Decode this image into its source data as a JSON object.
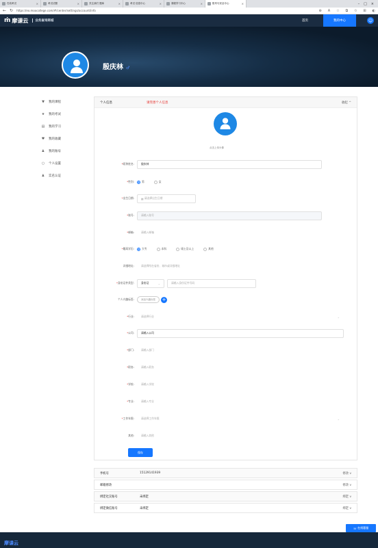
{
  "browser": {
    "tabs": [
      {
        "label": "在线考试"
      },
      {
        "label": "考试试题"
      },
      {
        "label": "关注我们 题库"
      },
      {
        "label": "考试 信息中心"
      },
      {
        "label": "课程学习中心"
      },
      {
        "label": "账号与安全中心"
      }
    ],
    "url": "https://eo.moocollege.com/#/center/settings/account/info"
  },
  "header": {
    "logo": "摩课云",
    "subtitle": "业务查询商城",
    "link": "首页",
    "cta": "我的中心"
  },
  "profile": {
    "name": "殷庆林",
    "gender_symbol": "♂"
  },
  "sidebar": {
    "items": [
      {
        "icon": "bookmark-icon",
        "glyph": "▼",
        "label": "我的课程"
      },
      {
        "icon": "star-icon",
        "glyph": "★",
        "label": "我的考试"
      },
      {
        "icon": "book-icon",
        "glyph": "▤",
        "label": "我的学习"
      },
      {
        "icon": "heart-icon",
        "glyph": "♥",
        "label": "我的收藏"
      },
      {
        "icon": "user-icon",
        "glyph": "♟",
        "label": "我的账号"
      },
      {
        "icon": "gear-icon",
        "glyph": "○",
        "label": "个人设置"
      },
      {
        "icon": "person-icon",
        "glyph": "♟",
        "label": "实名认证"
      }
    ]
  },
  "main": {
    "title": "个人信息",
    "notice": "请完善个人信息",
    "fold": "收起 ^",
    "upload_label": "点击上传头像",
    "fields": {
      "nickname": {
        "label": "昵称姓名",
        "value": "殷庆林"
      },
      "gender": {
        "label": "性别",
        "options": [
          "男",
          "女"
        ],
        "selected": "男"
      },
      "birthday": {
        "label": "出生日期",
        "placeholder": "请选择出生日期"
      },
      "account": {
        "label": "账号",
        "placeholder": "请输入账号"
      },
      "email": {
        "label": "邮箱",
        "placeholder": "请输入邮箱"
      },
      "education": {
        "label": "最高学历",
        "options": [
          "大专",
          "本科",
          "硕士及以上",
          "其他"
        ],
        "selected": "大专"
      },
      "address": {
        "label": "详细地址",
        "placeholder": "请选择所在省份、城市或详细地址"
      },
      "id": {
        "label": "身份证件类型",
        "type": "身份证",
        "placeholder": "请输入身份证件号码"
      },
      "tags": {
        "label": "个人兴趣标签",
        "button": "添加兴趣标签"
      },
      "industry": {
        "label": "行业",
        "placeholder": "请选择行业"
      },
      "company": {
        "label": "公司",
        "value": "请输入公司"
      },
      "dept": {
        "label": "部门",
        "placeholder": "请输入部门"
      },
      "title": {
        "label": "职务",
        "placeholder": "请输入职务"
      },
      "school": {
        "label": "学校",
        "placeholder": "请输入学校"
      },
      "major": {
        "label": "专业",
        "placeholder": "请输入专业"
      },
      "job_years": {
        "label": "工作年限",
        "placeholder": "请选择工作年限"
      },
      "other": {
        "label": "其他",
        "placeholder": "请输入其他"
      }
    },
    "save": "保存"
  },
  "info_rows": [
    {
      "label": "手机号",
      "value": "15129141939",
      "action": "修改 v"
    },
    {
      "label": "邮箱修改",
      "value": "",
      "action": "修改 v"
    },
    {
      "label": "绑定社交账号",
      "value": "未绑定",
      "action": "绑定 v"
    },
    {
      "label": "绑定微信账号",
      "value": "未绑定",
      "action": "绑定 v"
    }
  ],
  "float_button": "在线客服",
  "footer": {
    "logo": "摩课云"
  },
  "colors": {
    "primary": "#1677ff",
    "header": "#1a2c41",
    "required": "#e53935"
  }
}
